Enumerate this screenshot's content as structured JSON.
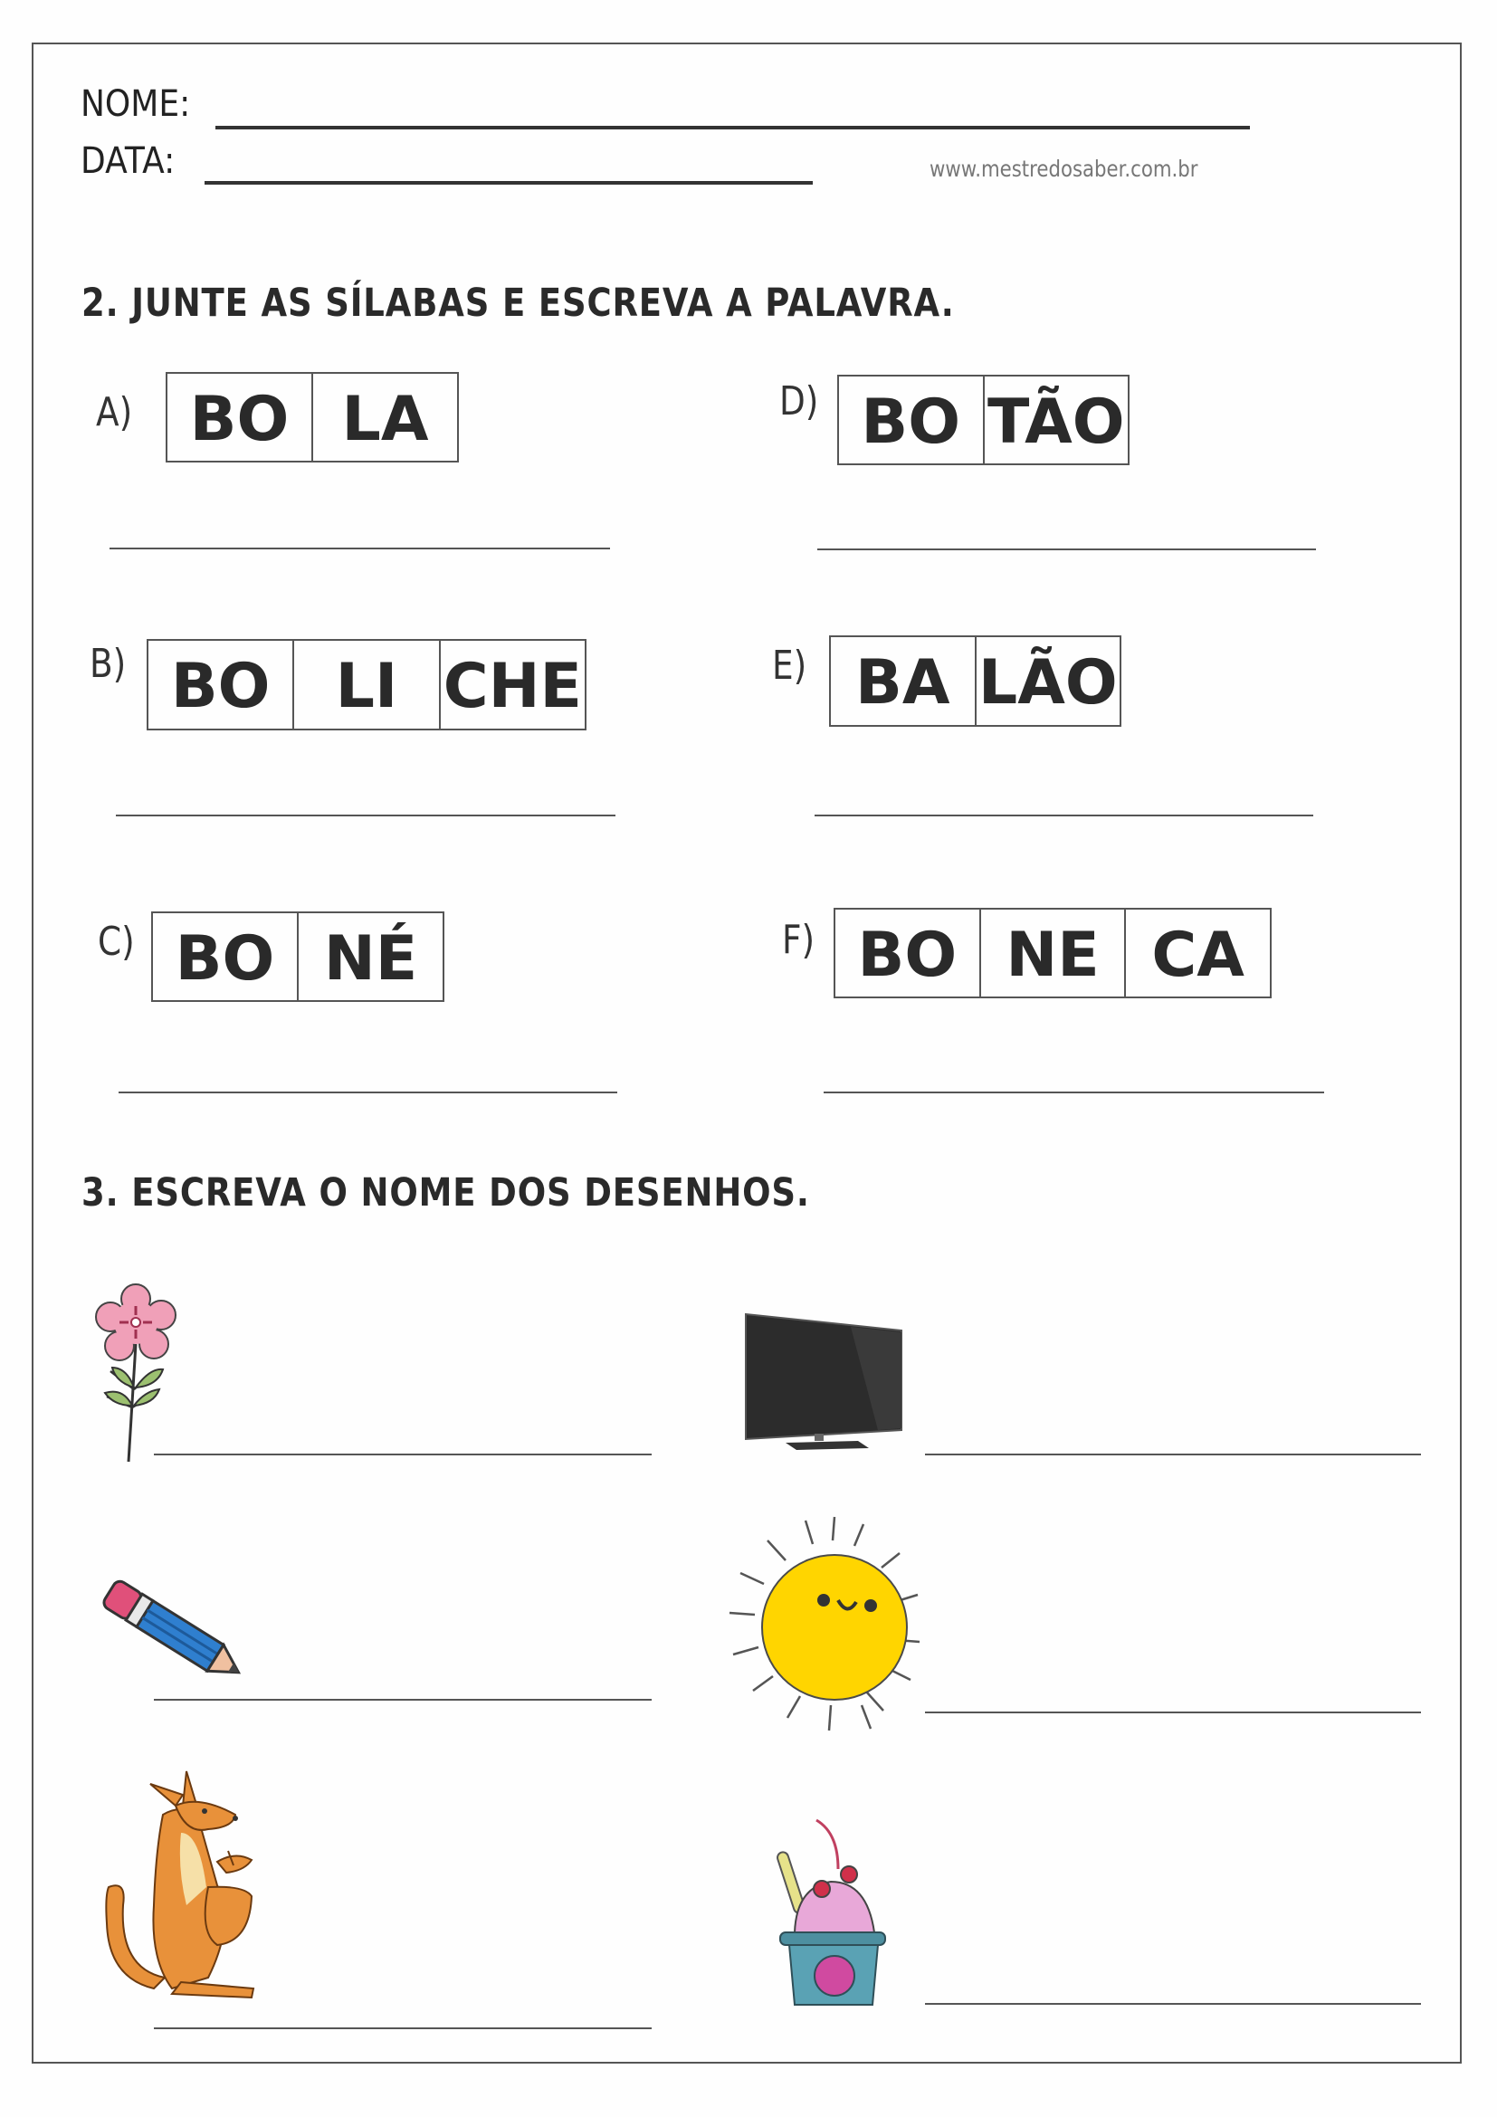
{
  "header": {
    "name_label": "NOME:",
    "date_label": "DATA:",
    "website": "www.mestredosaber.com.br"
  },
  "exercise2": {
    "title": "2. JUNTE AS SÍLABAS E ESCREVA A PALAVRA.",
    "items": [
      {
        "label": "A)",
        "syllables": [
          "BO",
          "LA"
        ]
      },
      {
        "label": "B)",
        "syllables": [
          "BO",
          "LI",
          "CHE"
        ]
      },
      {
        "label": "C)",
        "syllables": [
          "BO",
          "NÉ"
        ]
      },
      {
        "label": "D)",
        "syllables": [
          "BO",
          "TÃO"
        ]
      },
      {
        "label": "E)",
        "syllables": [
          "BA",
          "LÃO"
        ]
      },
      {
        "label": "F)",
        "syllables": [
          "BO",
          "NE",
          "CA"
        ]
      }
    ]
  },
  "exercise3": {
    "title": "3. ESCREVA O NOME DOS DESENHOS.",
    "pictures": [
      {
        "icon": "flower-icon"
      },
      {
        "icon": "television-icon"
      },
      {
        "icon": "pencil-icon"
      },
      {
        "icon": "sun-icon"
      },
      {
        "icon": "kangaroo-icon"
      },
      {
        "icon": "ice-cream-icon"
      }
    ]
  },
  "colors": {
    "flower_petal": "#f0a0b8",
    "leaf": "#9cc070",
    "sun": "#ffd500",
    "kangaroo": "#e8913a",
    "pencil_body": "#2f7fcf",
    "eraser": "#e0507a",
    "cup": "#4d8fa0",
    "cream": "#e8a8d8"
  }
}
